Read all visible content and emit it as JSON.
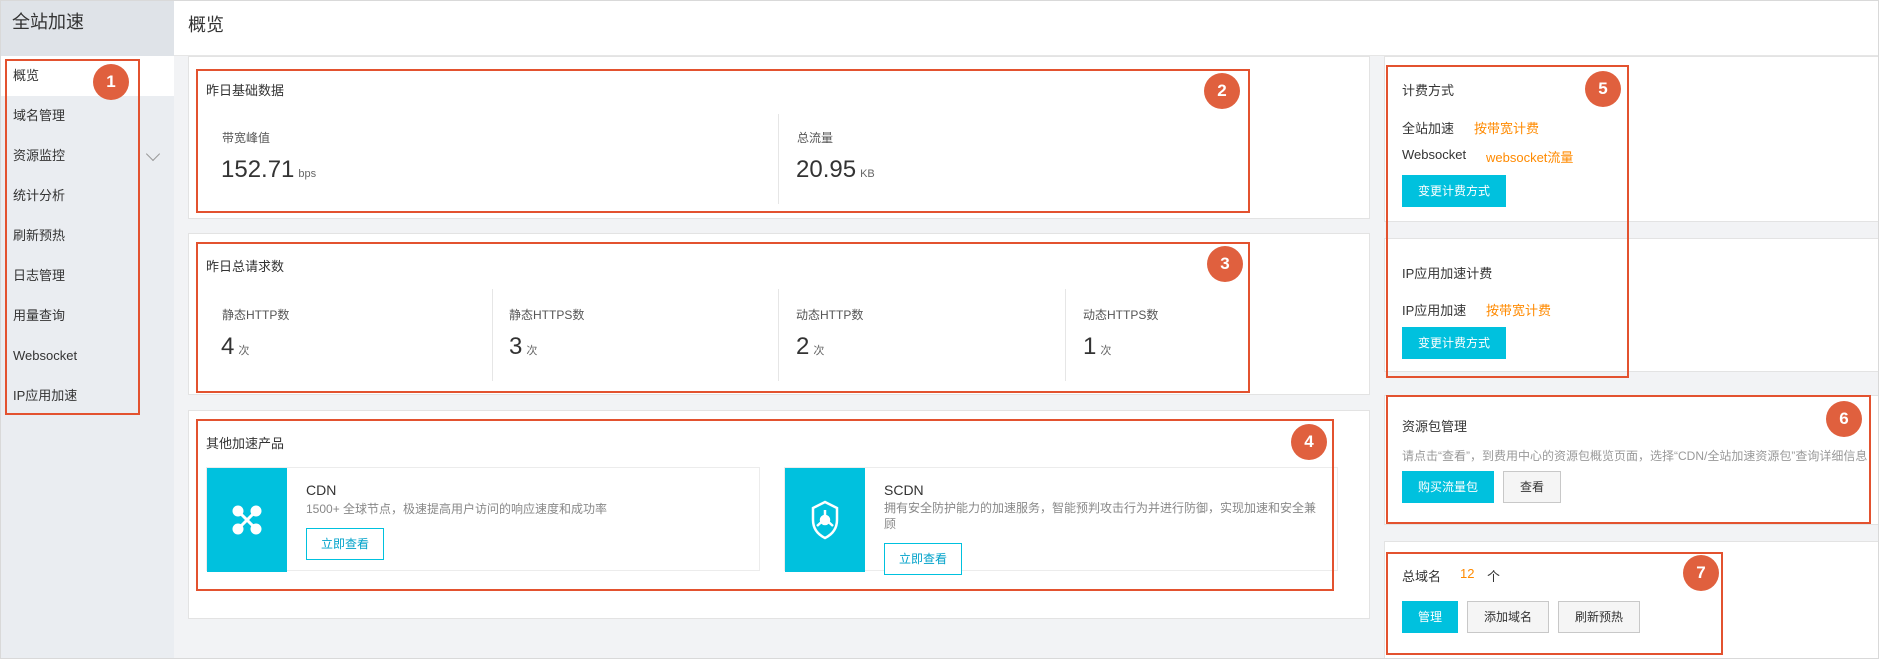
{
  "sidebar": {
    "title": "全站加速",
    "items": [
      {
        "label": "概览"
      },
      {
        "label": "域名管理"
      },
      {
        "label": "资源监控"
      },
      {
        "label": "统计分析"
      },
      {
        "label": "刷新预热"
      },
      {
        "label": "日志管理"
      },
      {
        "label": "用量查询"
      },
      {
        "label": "Websocket"
      },
      {
        "label": "IP应用加速"
      }
    ]
  },
  "header": {
    "title": "概览"
  },
  "yesterday_basic": {
    "title": "昨日基础数据",
    "bandwidth_label": "带宽峰值",
    "bandwidth_value": "152.71",
    "bandwidth_unit": "bps",
    "traffic_label": "总流量",
    "traffic_value": "20.95",
    "traffic_unit": "KB"
  },
  "yesterday_requests": {
    "title": "昨日总请求数",
    "items": [
      {
        "label": "静态HTTP数",
        "value": "4",
        "unit": "次"
      },
      {
        "label": "静态HTTPS数",
        "value": "3",
        "unit": "次"
      },
      {
        "label": "动态HTTP数",
        "value": "2",
        "unit": "次"
      },
      {
        "label": "动态HTTPS数",
        "value": "1",
        "unit": "次"
      }
    ]
  },
  "other_products": {
    "title": "其他加速产品",
    "products": [
      {
        "name": "CDN",
        "desc": "1500+ 全球节点，极速提高用户访问的响应速度和成功率",
        "button": "立即查看"
      },
      {
        "name": "SCDN",
        "desc": "拥有安全防护能力的加速服务，智能预判攻击行为并进行防御，实现加速和安全兼顾",
        "button": "立即查看"
      }
    ]
  },
  "billing": {
    "title": "计费方式",
    "rows": [
      {
        "label": "全站加速",
        "value": "按带宽计费"
      },
      {
        "label": "Websocket",
        "value": "websocket流量"
      }
    ],
    "change_button": "变更计费方式",
    "ip_title": "IP应用加速计费",
    "ip_row": {
      "label": "IP应用加速",
      "value": "按带宽计费"
    },
    "ip_change_button": "变更计费方式"
  },
  "resource_pack": {
    "title": "资源包管理",
    "hint": "请点击“查看”，到费用中心的资源包概览页面，选择“CDN/全站加速资源包”查询详细信息",
    "buy_button": "购买流量包",
    "view_button": "查看"
  },
  "domains": {
    "label": "总域名",
    "count": "12",
    "unit": "个",
    "manage_button": "管理",
    "add_button": "添加域名",
    "refresh_button": "刷新预热"
  },
  "badges": [
    "1",
    "2",
    "3",
    "4",
    "5",
    "6",
    "7"
  ],
  "colors": {
    "accent": "#00c1de",
    "highlight": "#e3522f",
    "badge": "#e0603e",
    "orange_value": "#ff8a00"
  }
}
